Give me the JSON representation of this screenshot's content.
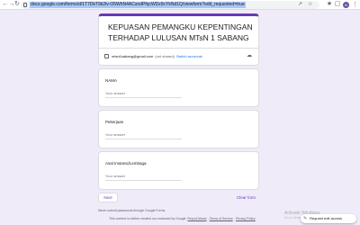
{
  "browser": {
    "url": "docs.google.com/forms/d/1T7DkT9k2lv-O5WhN4ACsndPfqcWDz9cYkNd1Q/viewform?edit_requested=true",
    "back_icon": "arrow-left-icon",
    "forward_icon": "arrow-right-icon",
    "reload_icon": "reload-icon",
    "profile_initial": "N"
  },
  "form": {
    "title": "KEPUASAN PEMANGKU KEPENTINGAN TERHADAP LULUSAN MTsN 1 SABANG",
    "account_email": "mtsn1sabang@gmail.com",
    "not_shared": "(not shared)",
    "switch_accounts": "Switch accounts",
    "accent_color": "#673ab7"
  },
  "questions": [
    {
      "label": "NAMA",
      "placeholder": "Your answer"
    },
    {
      "label": "Pekerjaan",
      "placeholder": "Your answer"
    },
    {
      "label": "Asal Instansi/Lembaga",
      "placeholder": "Your answer"
    }
  ],
  "actions": {
    "next": "Next",
    "clear": "Clear form"
  },
  "notice": "Never submit passwords through Google Forms.",
  "footer": {
    "text": "This content is neither created nor endorsed by Google.",
    "report": "Report Abuse",
    "terms": "Terms of Service",
    "privacy": "Privacy Policy",
    "sep": " - "
  },
  "watermark": {
    "title": "Activate Windows",
    "subtitle": "Go to Settings to activate Windows."
  },
  "request_edit": "Request edit access"
}
